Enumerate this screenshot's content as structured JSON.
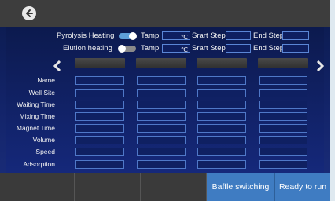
{
  "config": {
    "row1": {
      "label": "Pyrolysis Heating",
      "toggle_on": true,
      "tamp_label": "Tamp",
      "tamp_unit": "℃",
      "start_label": "Srart Step",
      "end_label": "End Step"
    },
    "row2": {
      "label": "Elution heating",
      "toggle_on": false,
      "tamp_label": "Tamp",
      "tamp_unit": "℃",
      "start_label": "Srart Step",
      "end_label": "End Step"
    }
  },
  "row_labels": [
    "Name",
    "Well Site",
    "Waiting Time",
    "Mixing Time",
    "Magnet Time",
    "Volume",
    "Speed",
    "Adsorption"
  ],
  "columns": 4,
  "bottom": {
    "baffle_label": "Baffle switching",
    "ready_label": "Ready to run"
  },
  "colors": {
    "accent": "#3f7cc2",
    "panel": "#13246a",
    "bar": "#3a3a3a"
  }
}
